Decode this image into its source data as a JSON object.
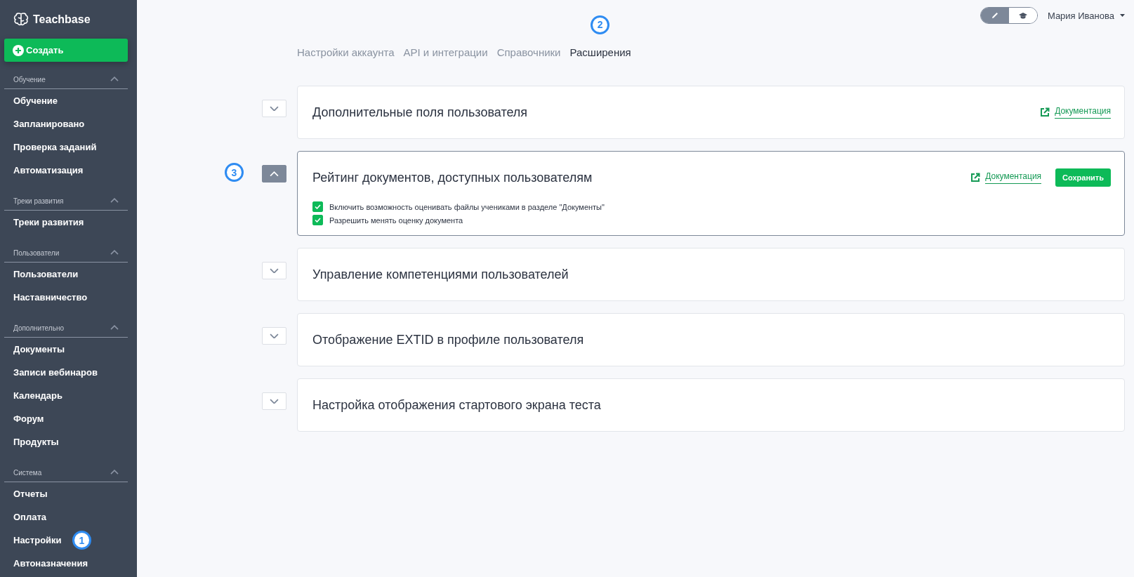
{
  "sidebar": {
    "logo": "Teachbase",
    "create_button": "Создать",
    "sections": [
      {
        "title": "Обучение",
        "expanded": true,
        "items": [
          {
            "label": "Обучение"
          },
          {
            "label": "Запланировано"
          },
          {
            "label": "Проверка заданий"
          },
          {
            "label": "Автоматизация"
          }
        ]
      },
      {
        "title": "Треки развития",
        "expanded": true,
        "items": [
          {
            "label": "Треки развития"
          }
        ]
      },
      {
        "title": "Пользователи",
        "expanded": true,
        "items": [
          {
            "label": "Пользователи"
          },
          {
            "label": "Наставничество"
          }
        ]
      },
      {
        "title": "Дополнительно",
        "expanded": true,
        "items": [
          {
            "label": "Документы"
          },
          {
            "label": "Записи вебинаров"
          },
          {
            "label": "Календарь"
          },
          {
            "label": "Форум"
          },
          {
            "label": "Продукты"
          }
        ]
      },
      {
        "title": "Система",
        "expanded": true,
        "items": [
          {
            "label": "Отчеты"
          },
          {
            "label": "Оплата"
          },
          {
            "label": "Настройки",
            "callout": "1"
          },
          {
            "label": "Автоназначения"
          }
        ]
      }
    ]
  },
  "header": {
    "modes": [
      {
        "kind": "edit",
        "selected": true
      },
      {
        "kind": "learn",
        "selected": false
      }
    ],
    "user": "Мария Иванова"
  },
  "tabs": [
    {
      "label": "Настройки аккаунта",
      "selected": false
    },
    {
      "label": "API и интеграции",
      "selected": false
    },
    {
      "label": "Справочники",
      "selected": false
    },
    {
      "label": "Расширения",
      "selected": true,
      "callout": "2"
    }
  ],
  "panels": [
    {
      "title": "Дополнительные поля пользователя",
      "expanded": false,
      "doc_link": "Документация"
    },
    {
      "title": "Рейтинг документов, доступных пользователям",
      "expanded": true,
      "callout": "3",
      "doc_link": "Документация",
      "save_button": "Сохранить",
      "options": [
        {
          "label": "Включить возможность оценивать файлы учениками в разделе \"Документы\"",
          "checked": true
        },
        {
          "label": "Разрешить менять оценку документа",
          "checked": true
        }
      ]
    },
    {
      "title": "Управление компетенциями пользователей",
      "expanded": false
    },
    {
      "title": "Отображение EXTID в профиле пользователя",
      "expanded": false
    },
    {
      "title": "Настройка отображения стартового экрана теста",
      "expanded": false
    }
  ]
}
